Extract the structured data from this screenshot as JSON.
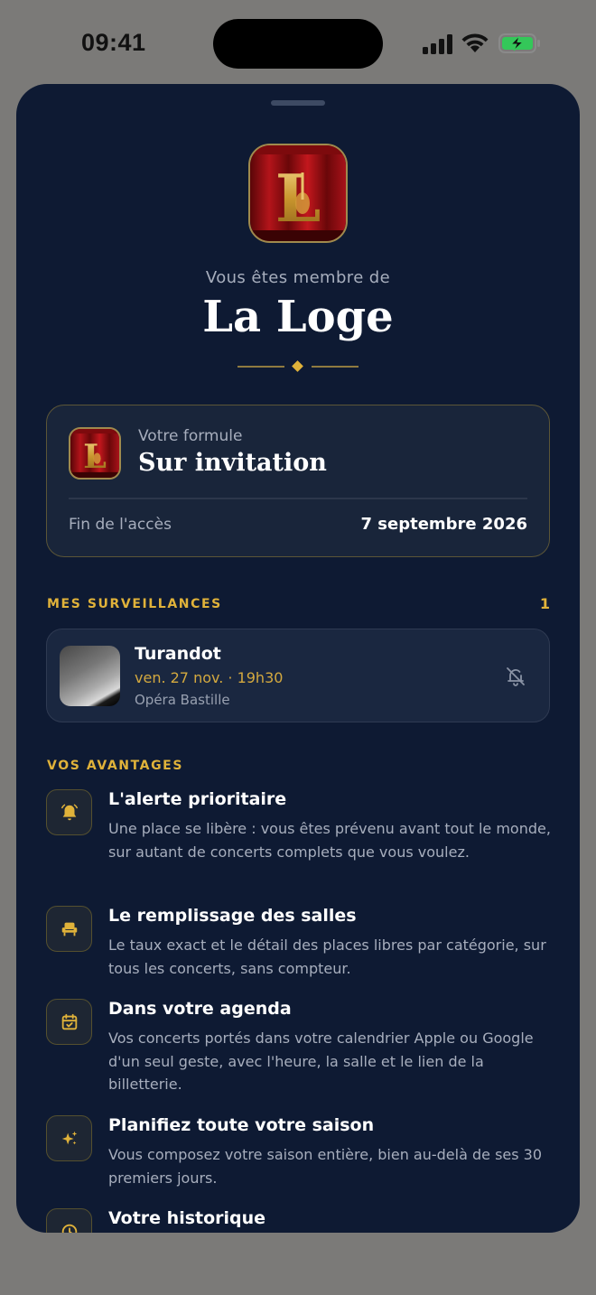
{
  "status_bar": {
    "time": "09:41"
  },
  "header": {
    "member_label": "Vous êtes membre de",
    "app_name": "La Loge",
    "logo_letter": "L"
  },
  "plan": {
    "caption": "Votre formule",
    "name": "Sur invitation",
    "access_label": "Fin de l'accès",
    "access_date": "7 septembre 2026"
  },
  "watches": {
    "header": "MES SURVEILLANCES",
    "count": "1",
    "items": [
      {
        "title": "Turandot",
        "date": "ven. 27 nov. · 19h30",
        "venue": "Opéra Bastille",
        "icon": "bell-off-icon"
      }
    ]
  },
  "benefits": {
    "header": "VOS AVANTAGES",
    "items": [
      {
        "icon": "bell-icon",
        "title": "L'alerte prioritaire",
        "description": "Une place se libère : vous êtes prévenu avant tout le monde, sur autant de concerts complets que vous voulez."
      },
      {
        "icon": "seat-icon",
        "title": "Le remplissage des salles",
        "description": "Le taux exact et le détail des places libres par catégorie, sur tous les concerts, sans compteur."
      },
      {
        "icon": "calendar-check-icon",
        "title": "Dans votre agenda",
        "description": "Vos concerts portés dans votre calendrier Apple ou Google d'un seul geste, avec l'heure, la salle et le lien de la billetterie."
      },
      {
        "icon": "sparkles-icon",
        "title": "Planifiez toute votre saison",
        "description": "Vous composez votre saison entière, bien au-delà de ses 30 premiers jours."
      },
      {
        "icon": "history-icon",
        "title": "Votre historique",
        "description": ""
      }
    ]
  },
  "colors": {
    "accent": "#e0b23a",
    "sheet_background": "#0e1a33",
    "card_background": "#19253a",
    "page_background": "#7b7a78"
  }
}
